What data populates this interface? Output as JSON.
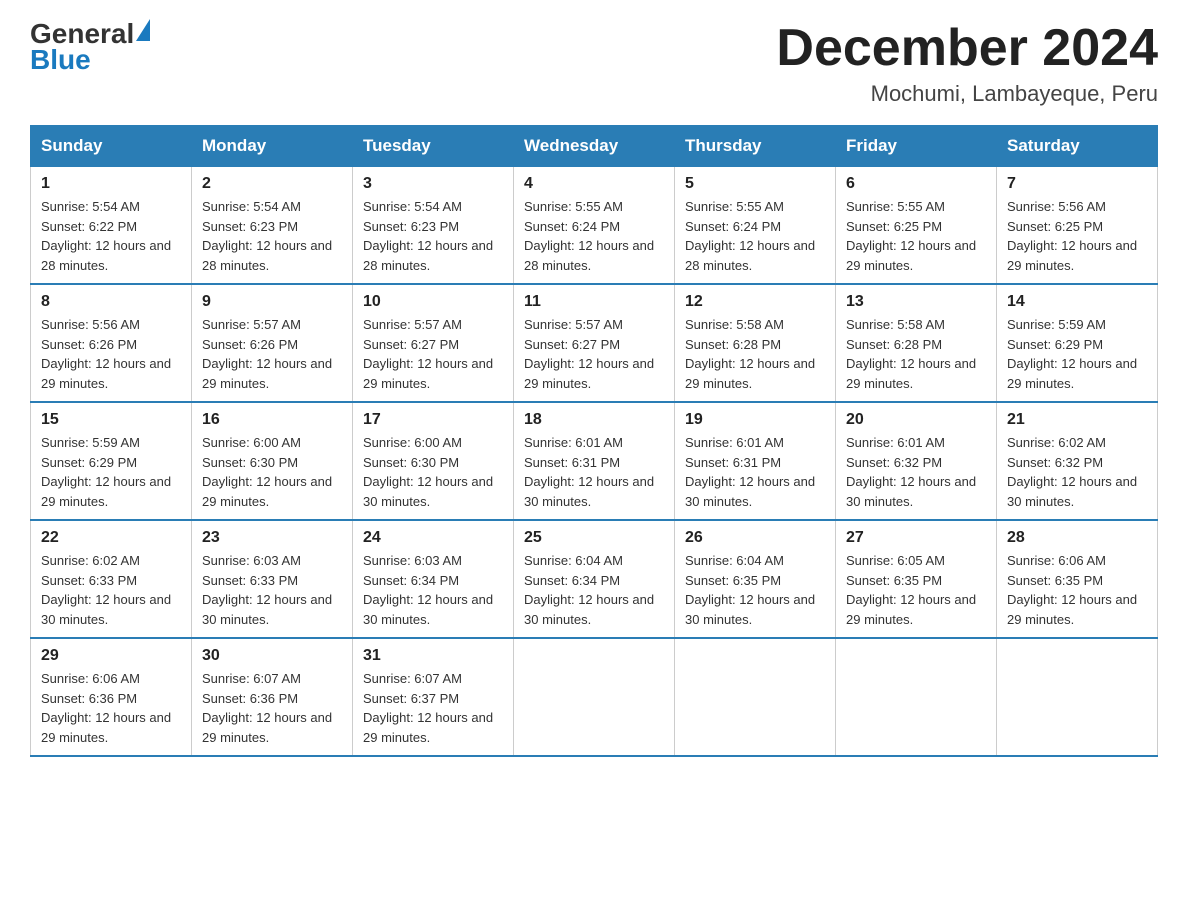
{
  "logo": {
    "general": "General",
    "blue": "Blue",
    "triangle": "▶"
  },
  "header": {
    "title": "December 2024",
    "location": "Mochumi, Lambayeque, Peru"
  },
  "weekdays": [
    "Sunday",
    "Monday",
    "Tuesday",
    "Wednesday",
    "Thursday",
    "Friday",
    "Saturday"
  ],
  "weeks": [
    [
      {
        "day": "1",
        "sunrise": "5:54 AM",
        "sunset": "6:22 PM",
        "daylight": "12 hours and 28 minutes."
      },
      {
        "day": "2",
        "sunrise": "5:54 AM",
        "sunset": "6:23 PM",
        "daylight": "12 hours and 28 minutes."
      },
      {
        "day": "3",
        "sunrise": "5:54 AM",
        "sunset": "6:23 PM",
        "daylight": "12 hours and 28 minutes."
      },
      {
        "day": "4",
        "sunrise": "5:55 AM",
        "sunset": "6:24 PM",
        "daylight": "12 hours and 28 minutes."
      },
      {
        "day": "5",
        "sunrise": "5:55 AM",
        "sunset": "6:24 PM",
        "daylight": "12 hours and 28 minutes."
      },
      {
        "day": "6",
        "sunrise": "5:55 AM",
        "sunset": "6:25 PM",
        "daylight": "12 hours and 29 minutes."
      },
      {
        "day": "7",
        "sunrise": "5:56 AM",
        "sunset": "6:25 PM",
        "daylight": "12 hours and 29 minutes."
      }
    ],
    [
      {
        "day": "8",
        "sunrise": "5:56 AM",
        "sunset": "6:26 PM",
        "daylight": "12 hours and 29 minutes."
      },
      {
        "day": "9",
        "sunrise": "5:57 AM",
        "sunset": "6:26 PM",
        "daylight": "12 hours and 29 minutes."
      },
      {
        "day": "10",
        "sunrise": "5:57 AM",
        "sunset": "6:27 PM",
        "daylight": "12 hours and 29 minutes."
      },
      {
        "day": "11",
        "sunrise": "5:57 AM",
        "sunset": "6:27 PM",
        "daylight": "12 hours and 29 minutes."
      },
      {
        "day": "12",
        "sunrise": "5:58 AM",
        "sunset": "6:28 PM",
        "daylight": "12 hours and 29 minutes."
      },
      {
        "day": "13",
        "sunrise": "5:58 AM",
        "sunset": "6:28 PM",
        "daylight": "12 hours and 29 minutes."
      },
      {
        "day": "14",
        "sunrise": "5:59 AM",
        "sunset": "6:29 PM",
        "daylight": "12 hours and 29 minutes."
      }
    ],
    [
      {
        "day": "15",
        "sunrise": "5:59 AM",
        "sunset": "6:29 PM",
        "daylight": "12 hours and 29 minutes."
      },
      {
        "day": "16",
        "sunrise": "6:00 AM",
        "sunset": "6:30 PM",
        "daylight": "12 hours and 29 minutes."
      },
      {
        "day": "17",
        "sunrise": "6:00 AM",
        "sunset": "6:30 PM",
        "daylight": "12 hours and 30 minutes."
      },
      {
        "day": "18",
        "sunrise": "6:01 AM",
        "sunset": "6:31 PM",
        "daylight": "12 hours and 30 minutes."
      },
      {
        "day": "19",
        "sunrise": "6:01 AM",
        "sunset": "6:31 PM",
        "daylight": "12 hours and 30 minutes."
      },
      {
        "day": "20",
        "sunrise": "6:01 AM",
        "sunset": "6:32 PM",
        "daylight": "12 hours and 30 minutes."
      },
      {
        "day": "21",
        "sunrise": "6:02 AM",
        "sunset": "6:32 PM",
        "daylight": "12 hours and 30 minutes."
      }
    ],
    [
      {
        "day": "22",
        "sunrise": "6:02 AM",
        "sunset": "6:33 PM",
        "daylight": "12 hours and 30 minutes."
      },
      {
        "day": "23",
        "sunrise": "6:03 AM",
        "sunset": "6:33 PM",
        "daylight": "12 hours and 30 minutes."
      },
      {
        "day": "24",
        "sunrise": "6:03 AM",
        "sunset": "6:34 PM",
        "daylight": "12 hours and 30 minutes."
      },
      {
        "day": "25",
        "sunrise": "6:04 AM",
        "sunset": "6:34 PM",
        "daylight": "12 hours and 30 minutes."
      },
      {
        "day": "26",
        "sunrise": "6:04 AM",
        "sunset": "6:35 PM",
        "daylight": "12 hours and 30 minutes."
      },
      {
        "day": "27",
        "sunrise": "6:05 AM",
        "sunset": "6:35 PM",
        "daylight": "12 hours and 29 minutes."
      },
      {
        "day": "28",
        "sunrise": "6:06 AM",
        "sunset": "6:35 PM",
        "daylight": "12 hours and 29 minutes."
      }
    ],
    [
      {
        "day": "29",
        "sunrise": "6:06 AM",
        "sunset": "6:36 PM",
        "daylight": "12 hours and 29 minutes."
      },
      {
        "day": "30",
        "sunrise": "6:07 AM",
        "sunset": "6:36 PM",
        "daylight": "12 hours and 29 minutes."
      },
      {
        "day": "31",
        "sunrise": "6:07 AM",
        "sunset": "6:37 PM",
        "daylight": "12 hours and 29 minutes."
      },
      null,
      null,
      null,
      null
    ]
  ]
}
